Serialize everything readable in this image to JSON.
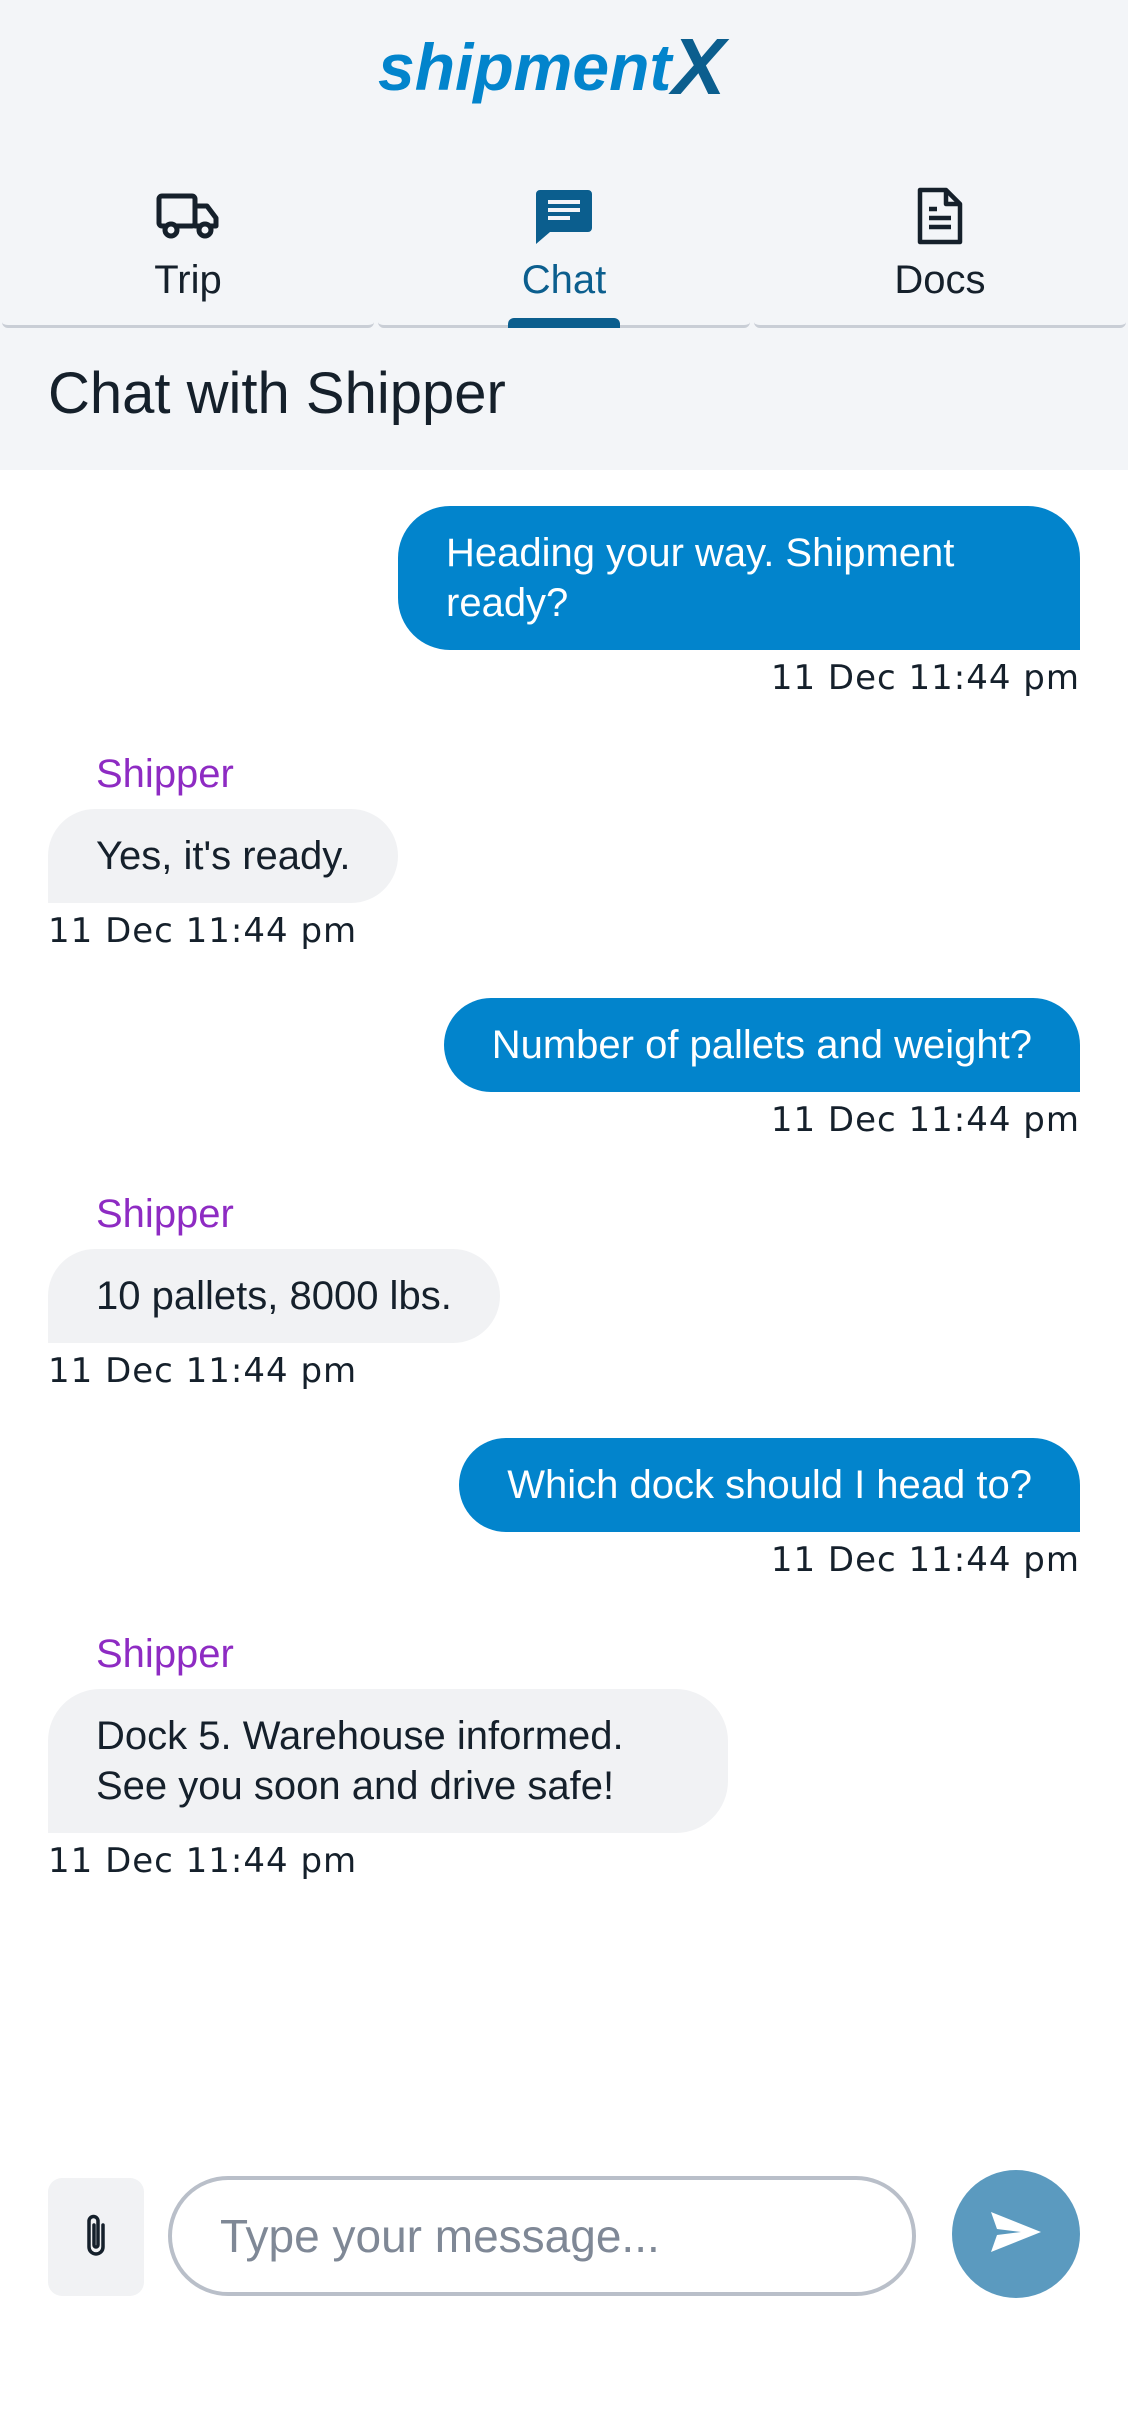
{
  "brand": {
    "logo_text_1": "shipment",
    "logo_text_2": "X",
    "primary_color": "#0284cc",
    "accent_color": "#0b5e8e"
  },
  "tabs": [
    {
      "label": "Trip",
      "icon": "truck-icon",
      "active": false
    },
    {
      "label": "Chat",
      "icon": "chat-icon",
      "active": true
    },
    {
      "label": "Docs",
      "icon": "document-icon",
      "active": false
    }
  ],
  "page_title": "Chat with Shipper",
  "messages": [
    {
      "direction": "outgoing",
      "text": "Heading your way. Shipment ready?",
      "time": "11 Dec 11:44 pm"
    },
    {
      "direction": "incoming",
      "sender": "Shipper",
      "text": "Yes, it's ready.",
      "time": "11 Dec 11:44 pm"
    },
    {
      "direction": "outgoing",
      "text": "Number of pallets and weight?",
      "time": "11 Dec 11:44 pm"
    },
    {
      "direction": "incoming",
      "sender": "Shipper",
      "text": "10 pallets, 8000 lbs.",
      "time": "11 Dec 11:44 pm"
    },
    {
      "direction": "outgoing",
      "text": "Which dock should I head to?",
      "time": "11 Dec 11:44 pm"
    },
    {
      "direction": "incoming",
      "sender": "Shipper",
      "text": "Dock 5. Warehouse informed. See you soon and drive safe!",
      "time": "11 Dec 11:44 pm"
    }
  ],
  "composer": {
    "placeholder": "Type your message...",
    "value": "",
    "attach_icon": "paperclip-icon",
    "send_icon": "send-icon"
  }
}
